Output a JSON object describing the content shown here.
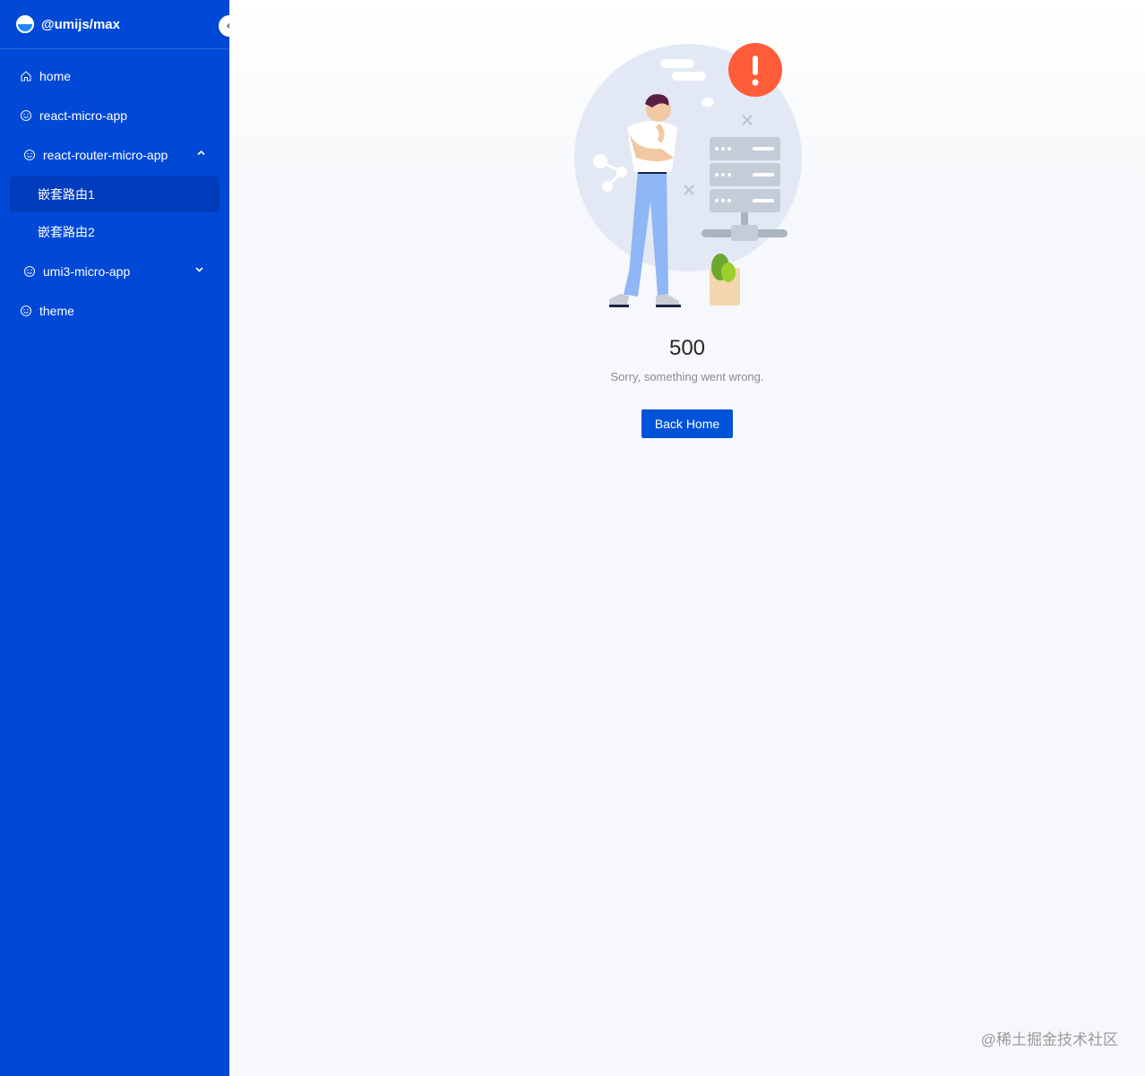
{
  "brand": {
    "title": "@umijs/max"
  },
  "menu": {
    "items": [
      {
        "label": "home",
        "icon": "home-icon"
      },
      {
        "label": "react-micro-app",
        "icon": "smile-icon"
      },
      {
        "label": "react-router-micro-app",
        "icon": "smile-icon",
        "expanded": true,
        "children": [
          {
            "label": "嵌套路由1",
            "active": true
          },
          {
            "label": "嵌套路由2"
          }
        ]
      },
      {
        "label": "umi3-micro-app",
        "icon": "smile-icon",
        "expanded": false
      },
      {
        "label": "theme",
        "icon": "smile-icon"
      }
    ]
  },
  "result": {
    "status": "500",
    "subtitle": "Sorry, something went wrong.",
    "button_label": "Back Home"
  },
  "watermark": "@稀土掘金技术社区",
  "colors": {
    "sidebar": "#0049d6",
    "active_item": "#003cbb",
    "primary_button": "#0052d9",
    "alert": "#ff5c3a"
  }
}
